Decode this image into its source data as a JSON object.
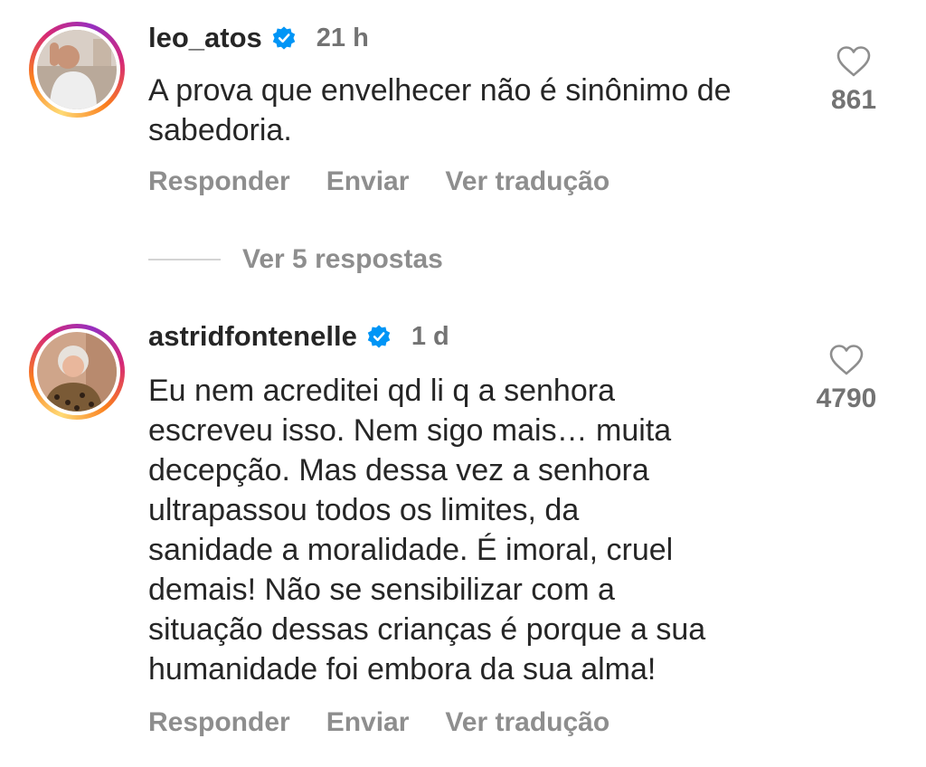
{
  "comments": [
    {
      "username": "leo_atos",
      "time": "21 h",
      "lines": [
        "A prova que envelhecer não é sinônimo de",
        "sabedoria."
      ],
      "likes": "861",
      "actions": {
        "reply": "Responder",
        "send": "Enviar",
        "translate": "Ver tradução"
      }
    },
    {
      "username": "astridfontenelle",
      "time": "1 d",
      "lines": [
        "Eu nem acreditei qd li q a senhora",
        "escreveu isso. Nem sigo mais… muita",
        "decepção. Mas dessa vez a senhora",
        "ultrapassou todos os limites, da",
        "sanidade a moralidade. É imoral, cruel",
        "demais! Não se sensibilizar com a",
        "situação dessas crianças é porque a sua",
        "humanidade foi embora da sua alma!"
      ],
      "likes": "4790",
      "actions": {
        "reply": "Responder",
        "send": "Enviar",
        "translate": "Ver tradução"
      }
    }
  ],
  "replies": {
    "label": "Ver 5 respostas"
  },
  "icons": {
    "verified": "verified-badge-icon",
    "like": "heart-outline-icon"
  },
  "colors": {
    "verified": "#0095f6",
    "secondary_text": "#8e8e8e",
    "primary_text": "#262626"
  }
}
